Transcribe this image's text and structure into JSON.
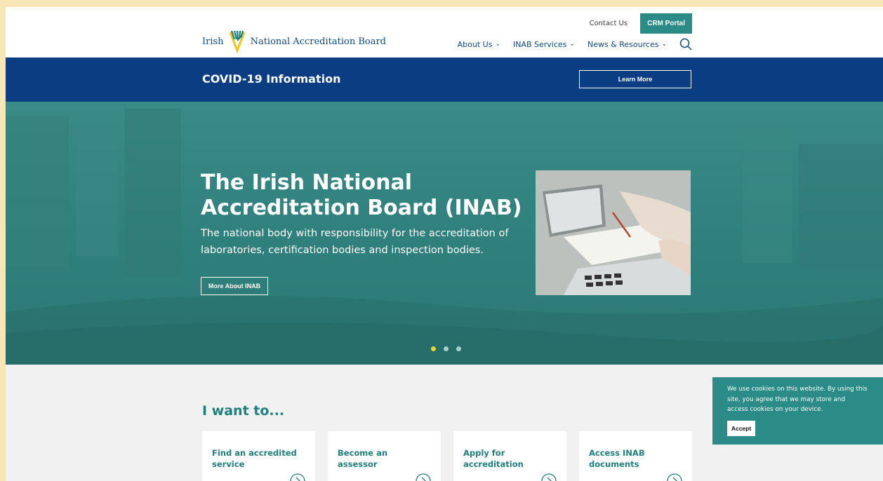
{
  "header": {
    "logo_left": "Irish",
    "logo_right": "National Accreditation Board",
    "contact_label": "Contact Us",
    "crm_label": "CRM Portal",
    "nav": [
      {
        "label": "About Us"
      },
      {
        "label": "INAB Services"
      },
      {
        "label": "News & Resources"
      }
    ]
  },
  "covid": {
    "title": "COVID-19 Information",
    "button": "Learn More"
  },
  "hero": {
    "title_line1": "The Irish National",
    "title_line2": "Accreditation Board (INAB)",
    "sub_line1": "The national body with responsibility for the accreditation of",
    "sub_line2": "laboratories, certification bodies and inspection bodies.",
    "button": "More About INAB",
    "slides": 3,
    "active_slide": 1
  },
  "iwant": {
    "heading": "I want to...",
    "cards": [
      {
        "line1": "Find an accredited",
        "line2": "service"
      },
      {
        "line1": "Become an assessor",
        "line2": ""
      },
      {
        "line1": "Apply for",
        "line2": "accreditation"
      },
      {
        "line1": "Access INAB",
        "line2": "documents"
      }
    ]
  },
  "cookie": {
    "text": "We use cookies on this website. By using this site, you agree that we may store and access cookies on your device.",
    "button": "Accept"
  },
  "colors": {
    "navy": "#0b3d82",
    "teal": "#2b8b87",
    "teal_text": "#1f7f7c",
    "yellow": "#f0d431",
    "page_bg": "#f8e6b6"
  }
}
